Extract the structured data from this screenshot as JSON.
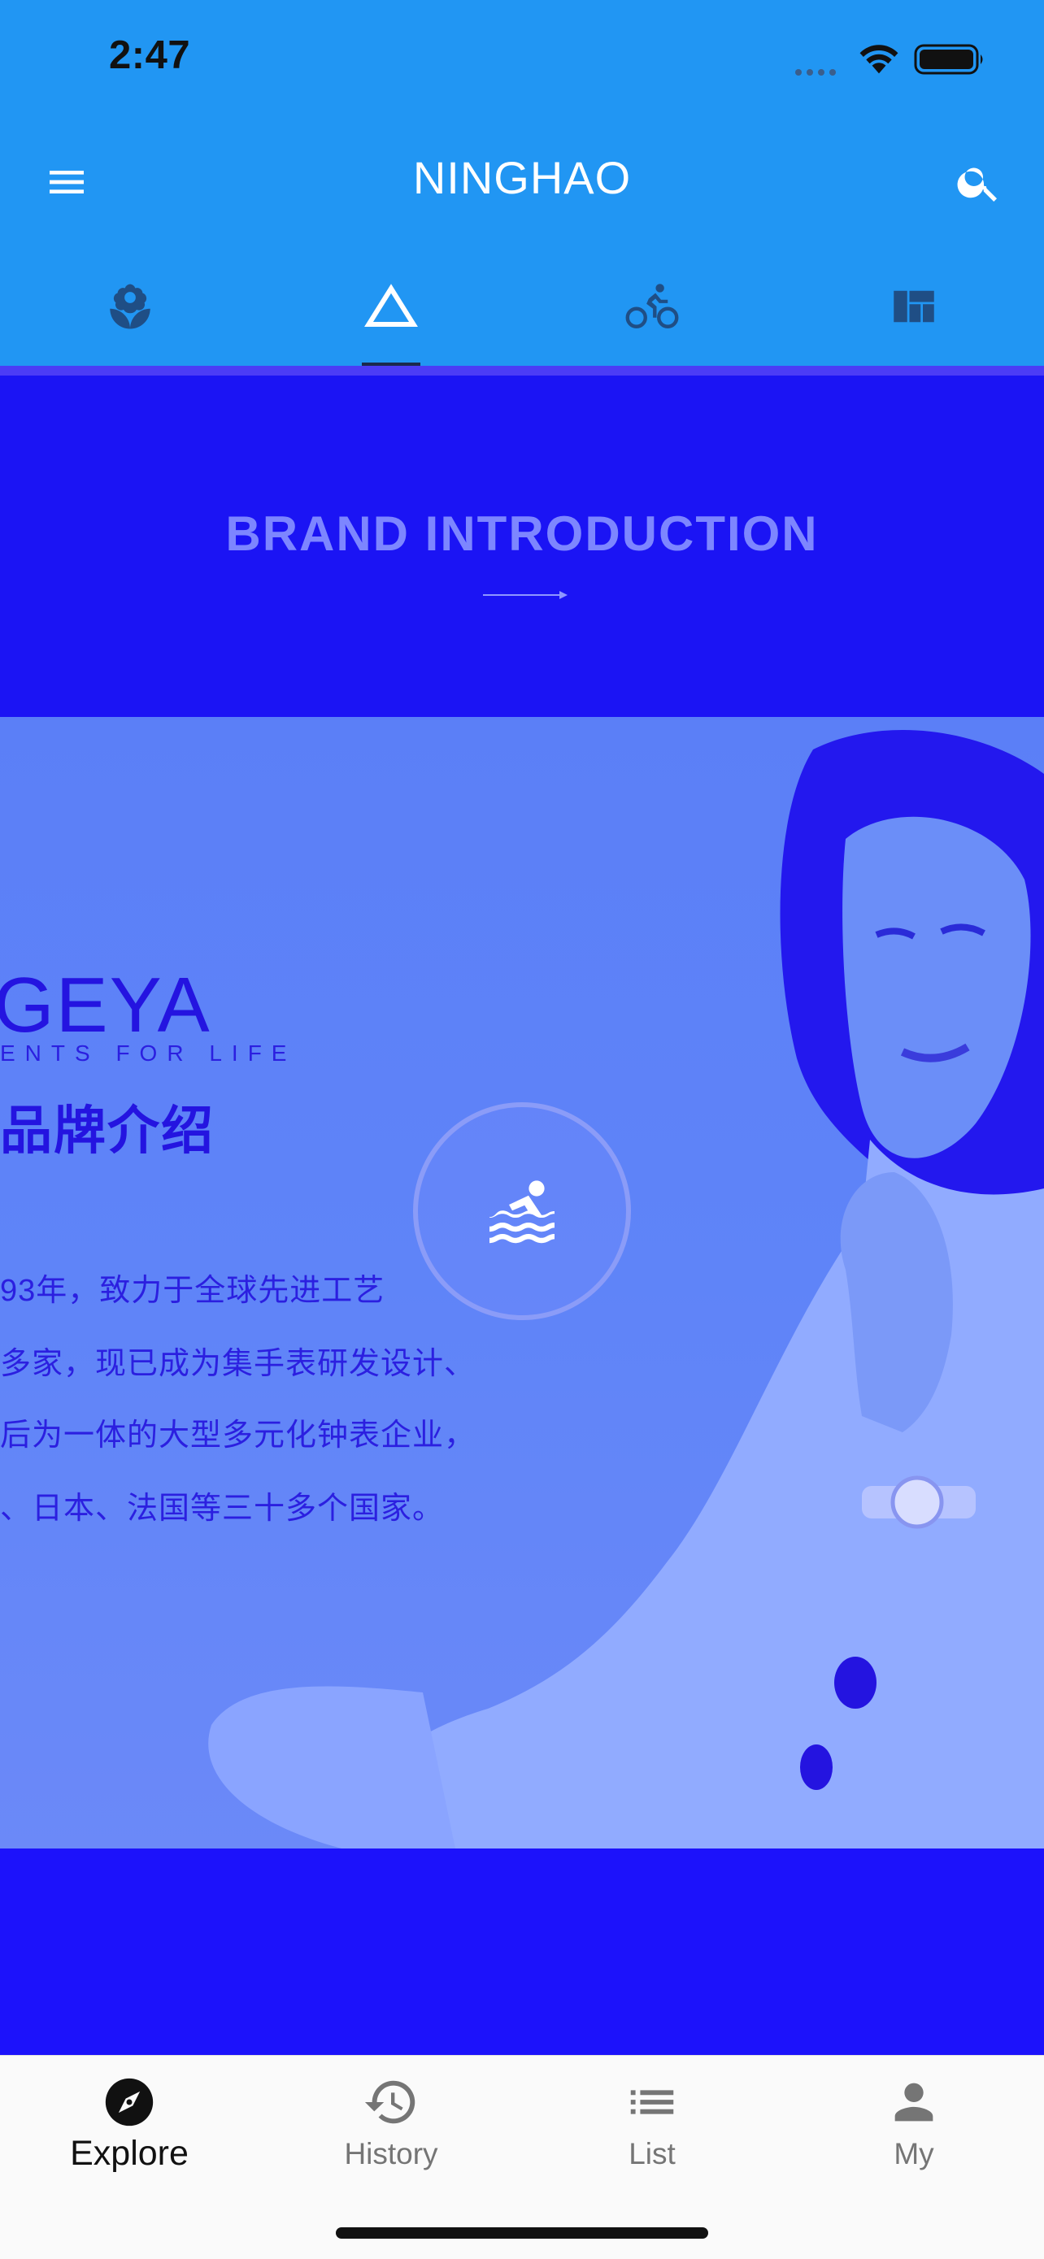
{
  "status_bar": {
    "time": "2:47"
  },
  "app_bar": {
    "title": "NINGHAO"
  },
  "tabs": [
    {
      "icon": "flower-icon",
      "selected": false
    },
    {
      "icon": "triangle-icon",
      "selected": true
    },
    {
      "icon": "bike-icon",
      "selected": false
    },
    {
      "icon": "dashboard-icon",
      "selected": false
    }
  ],
  "banner": {
    "title": "BRAND INTRODUCTION"
  },
  "brand_card": {
    "name": "GEYA",
    "tagline": "ENTS FOR LIFE",
    "heading": "品牌介绍",
    "lines": [
      "93年，致力于全球先进工艺",
      "多家，现已成为集手表研发设计、",
      "后为一体的大型多元化钟表企业，",
      "、日本、法国等三十多个国家。"
    ]
  },
  "fab_icon": "pool-icon",
  "bottom_nav": {
    "selected": "Explore",
    "items": [
      {
        "label": "Explore",
        "icon": "explore-icon"
      },
      {
        "label": "History",
        "icon": "history-icon"
      },
      {
        "label": "List",
        "icon": "list-icon"
      },
      {
        "label": "My",
        "icon": "person-icon"
      }
    ]
  },
  "colors": {
    "app_bar": "#2196f3",
    "banner": "#1b14f4",
    "overlay": "#1c12fb",
    "selected_nav": "#111111",
    "unselected_nav": "#757575"
  }
}
